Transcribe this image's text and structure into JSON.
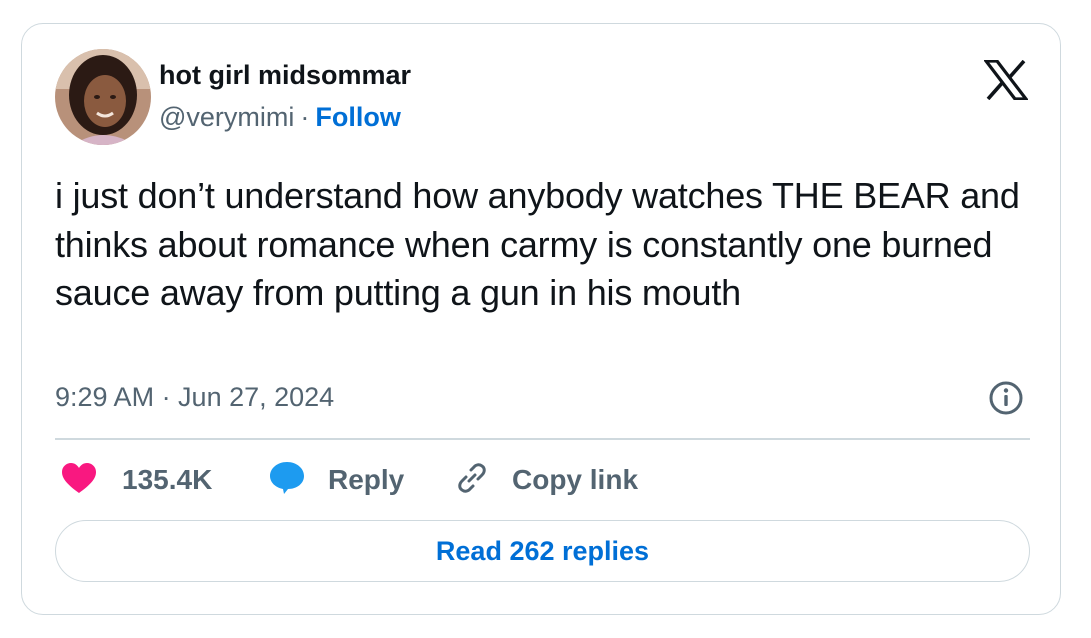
{
  "author": {
    "display_name": "hot girl midsommar",
    "handle": "@verymimi",
    "separator": "·",
    "follow_label": "Follow"
  },
  "icons": {
    "logo": "x-logo-icon",
    "info": "info-icon",
    "like": "heart-icon",
    "reply": "speech-bubble-icon",
    "copy": "link-icon"
  },
  "tweet": {
    "text": "i just don’t understand how anybody watches THE BEAR and thinks about romance when carmy is constantly one burned sauce away from putting a gun in his mouth",
    "timestamp": "9:29 AM · Jun 27, 2024"
  },
  "actions": {
    "like_count": "135.4K",
    "reply_label": "Reply",
    "copy_label": "Copy link"
  },
  "footer": {
    "read_replies_label": "Read 262 replies"
  },
  "colors": {
    "text": "#0f1419",
    "secondary": "#536471",
    "link": "#006fd6",
    "like": "#f91880",
    "reply": "#1d9bf0",
    "border": "#cfd9de"
  }
}
